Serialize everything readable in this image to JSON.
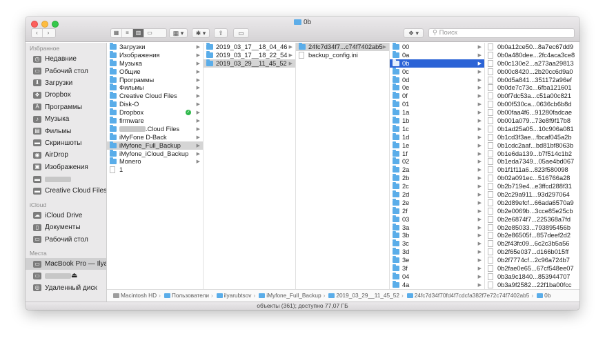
{
  "window": {
    "title": "0b"
  },
  "toolbar": {
    "back_glyph": "‹",
    "forward_glyph": "›",
    "search_placeholder": "Поиск",
    "search_icon": "magnifier-icon",
    "view_icons": [
      "icon-view-icon",
      "list-view-icon",
      "column-view-icon",
      "gallery-view-icon"
    ],
    "group_glyph": "▦ ▾",
    "action_glyph": "✱ ▾",
    "share_glyph": "⇧",
    "tag_glyph": "▭",
    "dropbox_glyph": "❖ ▾"
  },
  "sidebar": {
    "favorites_header": "Избранное",
    "favorites": [
      {
        "label": "Недавние",
        "icon": "recents-icon"
      },
      {
        "label": "Рабочий стол",
        "icon": "desktop-icon"
      },
      {
        "label": "Загрузки",
        "icon": "downloads-icon"
      },
      {
        "label": "Dropbox",
        "icon": "dropbox-icon"
      },
      {
        "label": "Программы",
        "icon": "applications-icon"
      },
      {
        "label": "Музыка",
        "icon": "music-icon"
      },
      {
        "label": "Фильмы",
        "icon": "movies-icon"
      },
      {
        "label": "Скриншоты",
        "icon": "folder-icon"
      },
      {
        "label": "AirDrop",
        "icon": "airdrop-icon"
      },
      {
        "label": "Изображения",
        "icon": "pictures-icon"
      },
      {
        "label": "",
        "icon": "folder-icon"
      },
      {
        "label": "Creative Cloud Files",
        "icon": "folder-icon"
      }
    ],
    "icloud_header": "iCloud",
    "icloud": [
      {
        "label": "iCloud Drive",
        "icon": "cloud-icon"
      },
      {
        "label": "Документы",
        "icon": "documents-icon"
      },
      {
        "label": "Рабочий стол",
        "icon": "desktop-icon"
      }
    ],
    "places_header": "Места",
    "places": [
      {
        "label": "MacBook Pro — Ilya",
        "icon": "laptop-icon"
      },
      {
        "label": "",
        "icon": "drive-icon"
      },
      {
        "label": "Удаленный диск",
        "icon": "remote-disk-icon"
      }
    ]
  },
  "columns": {
    "col1": [
      {
        "name": "Загрузки",
        "type": "folder"
      },
      {
        "name": "Изображения",
        "type": "folder"
      },
      {
        "name": "Музыка",
        "type": "folder"
      },
      {
        "name": "Общие",
        "type": "folder"
      },
      {
        "name": "Программы",
        "type": "folder"
      },
      {
        "name": "Фильмы",
        "type": "folder"
      },
      {
        "name": "Creative Cloud Files",
        "type": "folder"
      },
      {
        "name": "Disk-O",
        "type": "folder"
      },
      {
        "name": "Dropbox",
        "type": "folder"
      },
      {
        "name": "firmware",
        "type": "folder"
      },
      {
        "name": ".Cloud Files",
        "type": "folder"
      },
      {
        "name": "iMyFone D-Back",
        "type": "folder"
      },
      {
        "name": "iMyfone_Full_Backup",
        "type": "folder"
      },
      {
        "name": "iMyfone_iCloud_Backup",
        "type": "folder"
      },
      {
        "name": "Monero",
        "type": "folder"
      },
      {
        "name": "1",
        "type": "file"
      }
    ],
    "col2": [
      {
        "name": "2019_03_17__18_04_46",
        "type": "folder"
      },
      {
        "name": "2019_03_17__18_22_54",
        "type": "folder"
      },
      {
        "name": "2019_03_29__11_45_52",
        "type": "folder"
      }
    ],
    "col3": [
      {
        "name": "24fc7d34f7...c74f7402ab5",
        "type": "folder"
      },
      {
        "name": "backup_config.ini",
        "type": "file"
      }
    ],
    "col4": [
      "00",
      "0a",
      "0b",
      "0c",
      "0d",
      "0e",
      "0f",
      "01",
      "1a",
      "1b",
      "1c",
      "1d",
      "1e",
      "1f",
      "02",
      "2a",
      "2b",
      "2c",
      "2d",
      "2e",
      "2f",
      "03",
      "3a",
      "3b",
      "3c",
      "3d",
      "3e",
      "3f",
      "04",
      "4a"
    ],
    "col5": [
      "0b0a12ce50...8a7ec67dd9",
      "0b0a480dee...2fc4aca3ce8",
      "0b0c130e2...a273aa29813",
      "0b00c8420...2b20cc6d9a0",
      "0b0d5a841...351172a96ef",
      "0b0de7c73c...6fba121601",
      "0b0f7dc53a...c51a00c821",
      "0b00f530ca...0636cb6b8d",
      "0b00faa4f6...91280fadcae",
      "0b001a079...73e8f9f17b8",
      "0b1ad25a05...10c906a081",
      "0b1cd3f3ae...fbcaf045a2b",
      "0b1cdc2aaf...bd81bf8063b",
      "0b1e6da139...b7f514c1b2",
      "0b1eda7349...05ae4bd067",
      "0b1f1f11a6...823f580098",
      "0b02a091ec...516766a28",
      "0b2b719e4...e3ffcd288f31",
      "0b2c29a911...93d297064",
      "0b2d89efcf...66ada6570a9",
      "0b2e0069b...3cce85e25cb",
      "0b2e6874f7...225368a7fd",
      "0b2e85033...793895456b",
      "0b2e86505f...857deef2d2",
      "0b2f43fc09...6c2c3b5a56",
      "0b2f65e037...d166b015ff",
      "0b2f7774cf...2c96a724b7",
      "0b2fae0e65...67cf548ee07",
      "0b3a9c1840...853944707",
      "0b3a9f2582...22f1ba00fcc"
    ]
  },
  "pathbar": [
    "Macintosh HD",
    "Пользователи",
    "ilyarubtsov",
    "iMyfone_Full_Backup",
    "2019_03_29__11_45_52",
    "24fc7d34f70fd4f7cdcfa382f7e72c74f7402ab5",
    "0b"
  ],
  "status": "объекты (361); доступно 77,07 ГБ",
  "colors": {
    "selection": "#2b63d6",
    "folder": "#5aade9",
    "sidebar_bg": "#eae9ea"
  }
}
